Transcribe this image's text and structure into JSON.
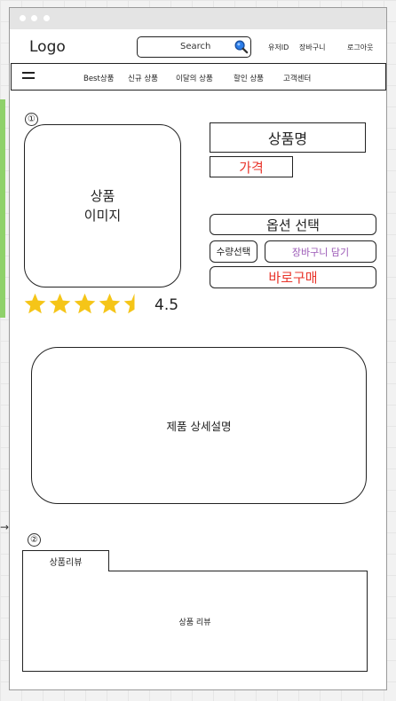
{
  "canvas": {
    "edge_arrow_glyph": "→"
  },
  "header": {
    "logo": "Logo",
    "search_placeholder": "Search",
    "links": [
      "유저ID",
      "장바구니",
      "로그아웃"
    ]
  },
  "nav": {
    "items": [
      "Best상품",
      "신규 상품",
      "이달의 상품",
      "할인 상품",
      "고객센터"
    ]
  },
  "product": {
    "section_marker": "①",
    "image_label_line1": "상품",
    "image_label_line2": "이미지",
    "name": "상품명",
    "price": "가격",
    "option_button": "옵션 선택",
    "quantity_button": "수량선택",
    "cart_button": "장바구니 담기",
    "buy_button": "바로구매",
    "rating": 4.5,
    "rating_text": "4.5",
    "max_stars": 5
  },
  "detail": {
    "label": "제품 상세설명"
  },
  "review": {
    "section_marker": "②",
    "tab_label": "상품리뷰",
    "panel_label": "상품 리뷰"
  },
  "colors": {
    "accent_red": "#e8352b",
    "accent_purple": "#9b59b6",
    "star_gold": "#f5c518",
    "search_icon_blue": "#2b7de9",
    "canvas_green": "#8fd16a"
  }
}
